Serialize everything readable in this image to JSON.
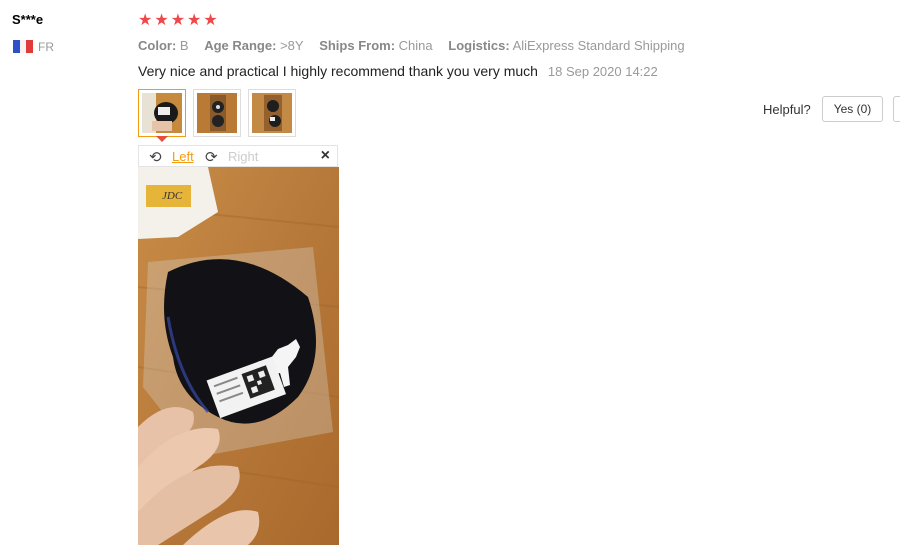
{
  "reviewer": {
    "name": "S***e",
    "country": "FR"
  },
  "rating": {
    "stars": 5
  },
  "attributes": [
    {
      "label": "Color:",
      "value": "B"
    },
    {
      "label": "Age Range:",
      "value": ">8Y"
    },
    {
      "label": "Ships From:",
      "value": "China"
    },
    {
      "label": "Logistics:",
      "value": "AliExpress Standard Shipping"
    }
  ],
  "review": {
    "text": "Very nice and practical I highly recommend thank you very much",
    "date": "18 Sep 2020 14:22"
  },
  "viewer": {
    "rotate_left": "Left",
    "rotate_right": "Right",
    "close_icon": "close-icon"
  },
  "feedback": {
    "helpful_label": "Helpful?",
    "yes_label": "Yes (0)"
  },
  "colors": {
    "star": "#f04848",
    "accent": "#f39c12",
    "text": "#333333"
  }
}
